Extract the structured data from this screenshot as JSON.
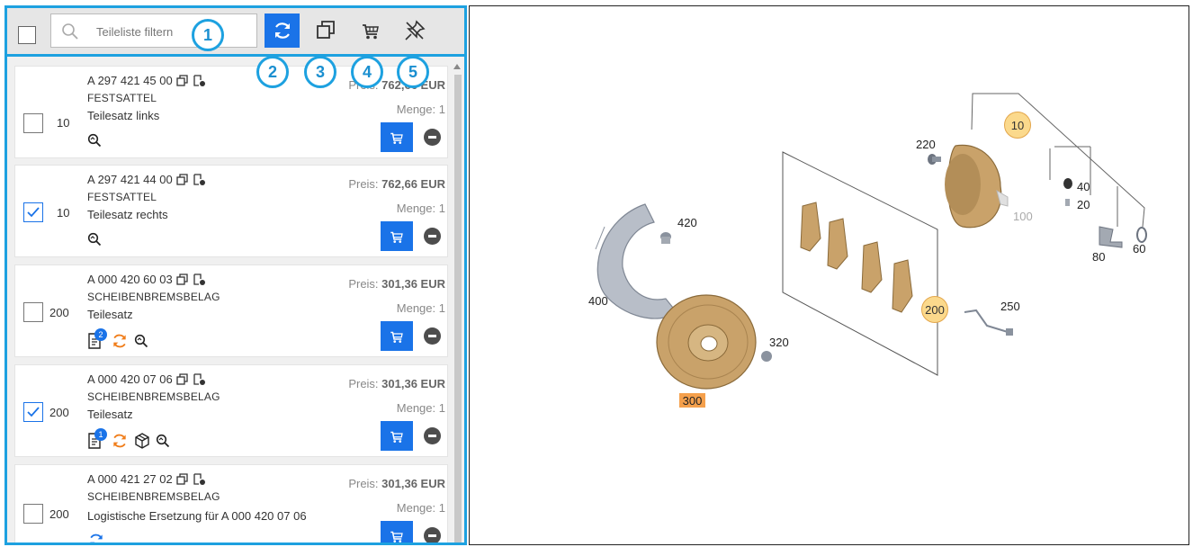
{
  "toolbar": {
    "filter_placeholder": "Teileliste filtern"
  },
  "callouts": [
    "1",
    "2",
    "3",
    "4",
    "5"
  ],
  "items": [
    {
      "part_no": "A 297 421 45 00",
      "title": "FESTSATTEL",
      "description": "Teilesatz links",
      "position": "10",
      "price_label": "Preis:",
      "price_value": "762,66 EUR",
      "qty_label": "Menge:",
      "qty_value": "1",
      "checked": false
    },
    {
      "part_no": "A 297 421 44 00",
      "title": "FESTSATTEL",
      "description": "Teilesatz rechts",
      "position": "10",
      "price_label": "Preis:",
      "price_value": "762,66 EUR",
      "qty_label": "Menge:",
      "qty_value": "1",
      "checked": true
    },
    {
      "part_no": "A 000 420 60 03",
      "title": "SCHEIBENBREMSBELAG",
      "description": "Teilesatz",
      "position": "200",
      "price_label": "Preis:",
      "price_value": "301,36 EUR",
      "qty_label": "Menge:",
      "qty_value": "1",
      "checked": false,
      "badge": "2"
    },
    {
      "part_no": "A 000 420 07 06",
      "title": "SCHEIBENBREMSBELAG",
      "description": "Teilesatz",
      "position": "200",
      "price_label": "Preis:",
      "price_value": "301,36 EUR",
      "qty_label": "Menge:",
      "qty_value": "1",
      "checked": true,
      "badge": "1"
    },
    {
      "part_no": "A 000 421 27 02",
      "title": "SCHEIBENBREMSBELAG",
      "description": "Logistische Ersetzung für A 000 420 07 06",
      "position": "200",
      "price_label": "Preis:",
      "price_value": "301,36 EUR",
      "qty_label": "Menge:",
      "qty_value": "1",
      "checked": false
    }
  ],
  "diagram": {
    "labels": [
      "10",
      "220",
      "40",
      "20",
      "100",
      "60",
      "80",
      "420",
      "400",
      "200",
      "250",
      "320",
      "300"
    ],
    "highlighted_circle": [
      "10",
      "200"
    ],
    "highlighted_rect": [
      "300"
    ],
    "colors": {
      "accent": "#1da1e0",
      "button_blue": "#1a73e8",
      "highlight_circle": "#fbd98c",
      "highlight_rect": "#f5a04c",
      "part_gold": "#c9a26a"
    }
  }
}
